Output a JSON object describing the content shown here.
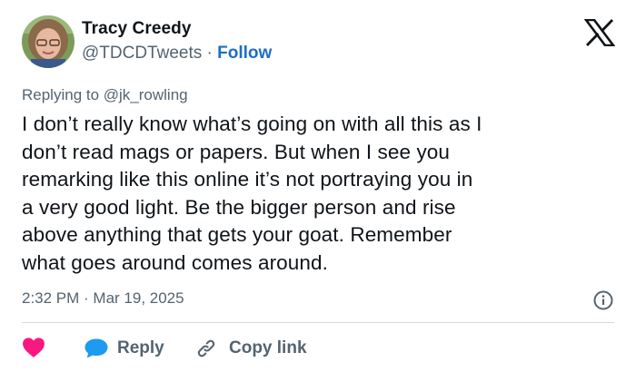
{
  "author": {
    "name": "Tracy Creedy",
    "handle": "@TDCDTweets",
    "separator": " · ",
    "follow_label": "Follow"
  },
  "reply_to": "Replying to @jk_rowling",
  "tweet": {
    "lines": [
      "I don’t really know what’s going on with all this as I",
      "don’t read mags or papers. But when I see you",
      "remarking like this online it’s not portraying you in",
      "a very good light. Be the bigger person and rise",
      "above anything that gets your goat. Remember",
      "what goes around comes around."
    ]
  },
  "timestamp": "2:32 PM · Mar 19, 2025",
  "actions": {
    "reply_label": "Reply",
    "copy_link_label": "Copy link"
  },
  "colors": {
    "accent": "#1d6ec6",
    "heart": "#f91880",
    "muted": "#536471",
    "divider": "#cfd9de"
  },
  "icons": {
    "brand": "x-logo-icon",
    "like": "heart-icon",
    "reply": "speech-bubble-icon",
    "copy": "link-icon",
    "info": "info-icon"
  }
}
